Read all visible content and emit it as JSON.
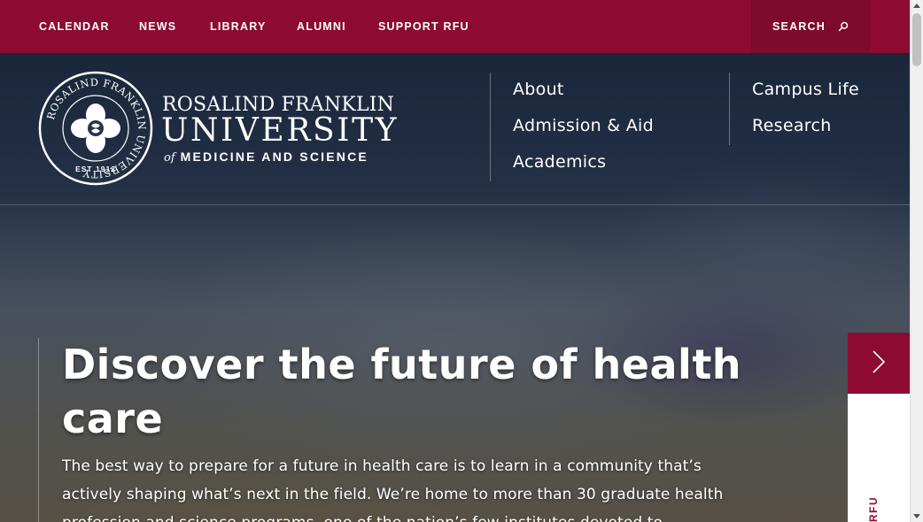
{
  "utility_nav": {
    "items": [
      {
        "label": "CALENDAR"
      },
      {
        "label": "NEWS"
      },
      {
        "label": "LIBRARY"
      },
      {
        "label": "ALUMNI"
      },
      {
        "label": "SUPPORT RFU"
      }
    ],
    "search_label": "SEARCH"
  },
  "logo": {
    "line1": "ROSALIND FRANKLIN",
    "line2": "UNIVERSITY",
    "line3_of": "of",
    "line3": "MEDICINE AND SCIENCE",
    "seal_ring_text": "ROSALIND FRANKLIN UNIVERSITY",
    "seal_est": "EST 1912"
  },
  "main_nav": {
    "column1": [
      "About",
      "Admission & Aid",
      "Academics"
    ],
    "column2": [
      "Campus Life",
      "Research"
    ]
  },
  "hero": {
    "title": "Discover the future of health care",
    "body": "The best way to prepare for a future in health care is to learn in a community that’s actively shaping what’s next in the field. We’re home to more than 30 graduate health profession and science programs, one of the nation’s few institutes devoted to"
  },
  "side_panel": {
    "label": "RFU"
  },
  "colors": {
    "brand": "#8d0b32",
    "brand_dark": "#7e0a2d",
    "text_on_dark": "#ffffff"
  }
}
